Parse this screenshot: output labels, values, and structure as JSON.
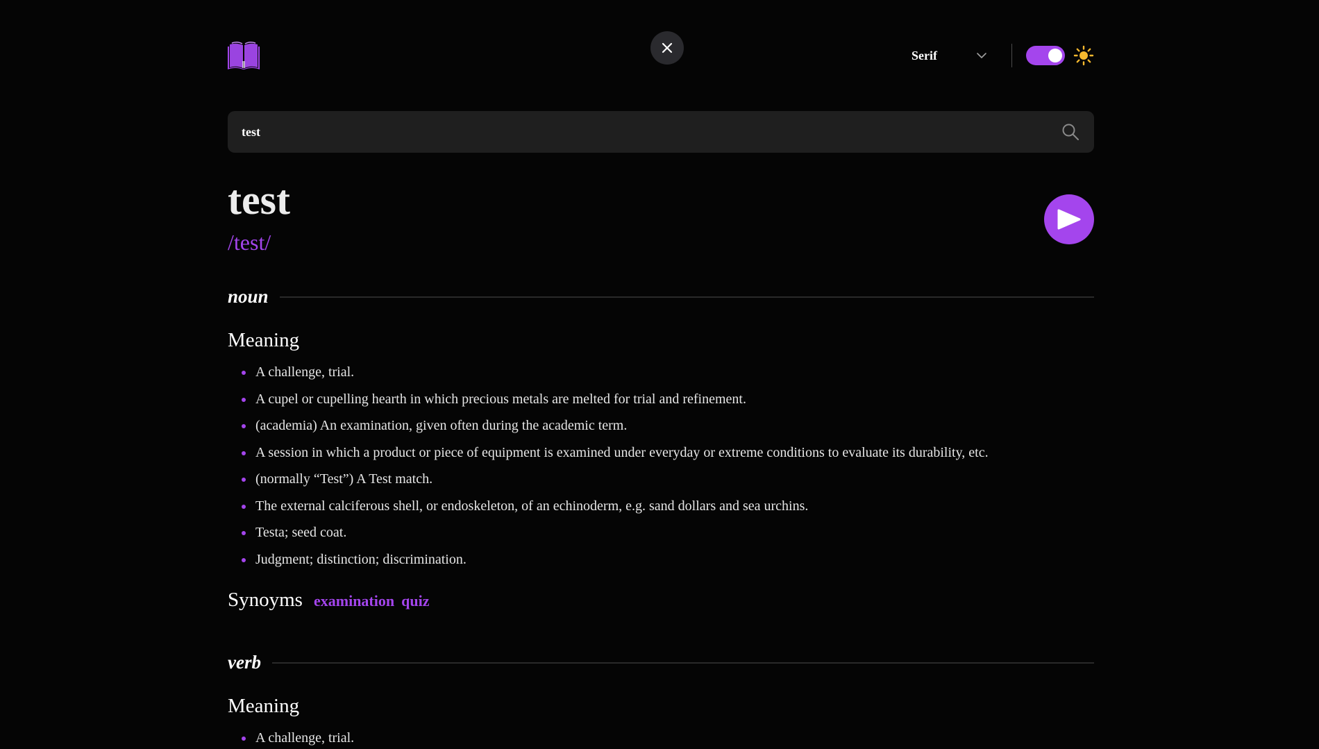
{
  "header": {
    "logo_icon": "book-icon",
    "close_icon": "close-icon",
    "font_select": {
      "selected": "Serif"
    },
    "theme_toggle": {
      "state": "on",
      "icon": "sun-icon"
    }
  },
  "search": {
    "value": "test",
    "icon": "search-icon"
  },
  "entry": {
    "word": "test",
    "phonetic": "/test/",
    "play_icon": "play-icon",
    "meanings": [
      {
        "part_of_speech": "noun",
        "meaning_label": "Meaning",
        "definitions": [
          "A challenge, trial.",
          "A cupel or cupelling hearth in which precious metals are melted for trial and refinement.",
          "(academia) An examination, given often during the academic term.",
          "A session in which a product or piece of equipment is examined under everyday or extreme conditions to evaluate its durability, etc.",
          "(normally “Test”) A Test match.",
          "The external calciferous shell, or endoskeleton, of an echinoderm, e.g. sand dollars and sea urchins.",
          "Testa; seed coat.",
          "Judgment; distinction; discrimination."
        ],
        "synonyms_label": "Synoyms",
        "synonyms": [
          "examination",
          "quiz"
        ]
      },
      {
        "part_of_speech": "verb",
        "meaning_label": "Meaning",
        "definitions": [
          "A challenge, trial."
        ]
      }
    ]
  },
  "colors": {
    "accent": "#a445ed",
    "background": "#050505",
    "search_bg": "#1f1f1f",
    "sun": "#f5b82e"
  }
}
